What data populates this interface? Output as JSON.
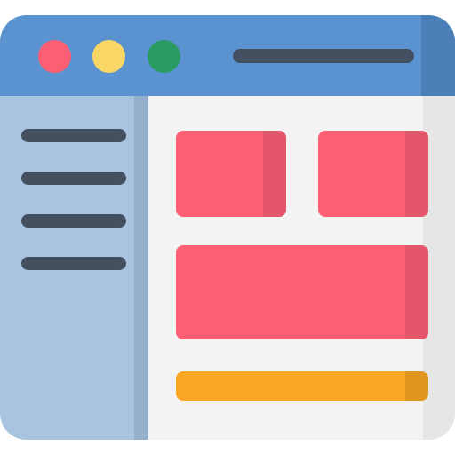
{
  "window": {
    "controls": [
      {
        "name": "close",
        "color": "#fc5f73"
      },
      {
        "name": "minimize",
        "color": "#f9d767"
      },
      {
        "name": "maximize",
        "color": "#2a9b64"
      }
    ],
    "address_bar_color": "#44505f",
    "titlebar_color": "#5a93d0"
  },
  "sidebar": {
    "background": "#a9c4e0",
    "items_count": 4
  },
  "main": {
    "card_color": "#fc5f73",
    "progress_bar_color": "#f9a724"
  }
}
